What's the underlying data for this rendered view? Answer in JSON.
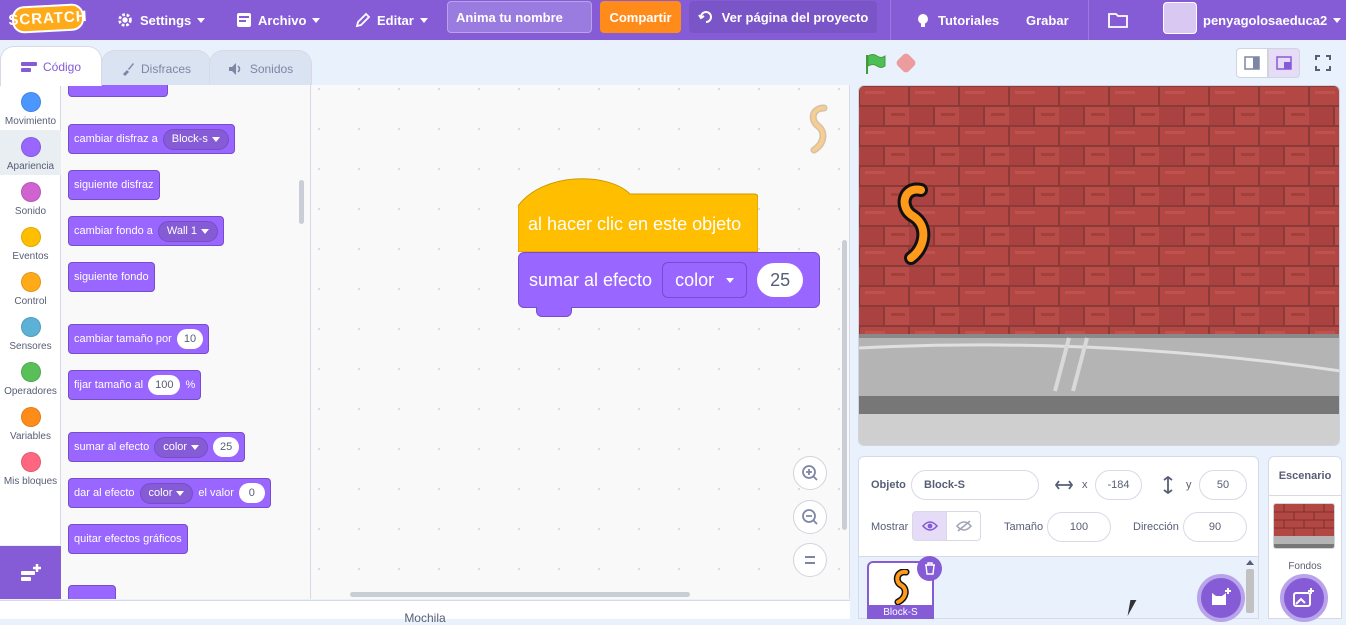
{
  "menu": {
    "logo": "SCRATCH",
    "settings": "Settings",
    "file": "Archivo",
    "edit": "Editar",
    "project_title": "Anima tu nombre",
    "share": "Compartir",
    "see_project": "Ver página del proyecto",
    "tutorials": "Tutoriales",
    "record": "Grabar",
    "username": "penyagolosaeduca2"
  },
  "tabs": [
    "Código",
    "Disfraces",
    "Sonidos"
  ],
  "categories": [
    {
      "label": "Movimiento",
      "color": "#4c97ff"
    },
    {
      "label": "Apariencia",
      "color": "#9966ff"
    },
    {
      "label": "Sonido",
      "color": "#cf63cf"
    },
    {
      "label": "Eventos",
      "color": "#ffbf00"
    },
    {
      "label": "Control",
      "color": "#ffab19"
    },
    {
      "label": "Sensores",
      "color": "#5cb1d6"
    },
    {
      "label": "Operadores",
      "color": "#59c059"
    },
    {
      "label": "Variables",
      "color": "#ff8c1a"
    },
    {
      "label": "Mis bloques",
      "color": "#ff6680"
    }
  ],
  "palette": {
    "switch_costume": "cambiar disfraz a",
    "switch_costume_value": "Block-s",
    "next_costume": "siguiente disfraz",
    "switch_backdrop": "cambiar fondo a",
    "switch_backdrop_value": "Wall 1",
    "next_backdrop": "siguiente fondo",
    "change_size": "cambiar tamaño por",
    "change_size_value": "10",
    "set_size": "fijar tamaño al",
    "set_size_value": "100",
    "set_size_unit": "%",
    "change_effect": "sumar al efecto",
    "change_effect_value": "color",
    "change_effect_amount": "25",
    "set_effect": "dar al efecto",
    "set_effect_value": "color",
    "set_effect_to": "el valor",
    "set_effect_amount": "0",
    "clear_effects": "quitar efectos gráficos"
  },
  "script": {
    "hat": "al hacer clic en este objeto",
    "stack": "sumar al efecto",
    "stack_effect": "color",
    "stack_amount": "25"
  },
  "backpack": "Mochila",
  "sprite_info": {
    "sprite_label": "Objeto",
    "sprite_name": "Block-S",
    "x_label": "x",
    "x_value": "-184",
    "y_label": "y",
    "y_value": "50",
    "show_label": "Mostrar",
    "size_label": "Tamaño",
    "size_value": "100",
    "direction_label": "Dirección",
    "direction_value": "90"
  },
  "sprites": [
    {
      "name": "Block-S"
    }
  ],
  "stage_panel": {
    "title": "Escenario",
    "backdrops_label": "Fondos"
  },
  "colors": {
    "accent": "#855cd6",
    "looks": "#9966ff",
    "events": "#ffbf00",
    "share": "#ff8c1a"
  }
}
